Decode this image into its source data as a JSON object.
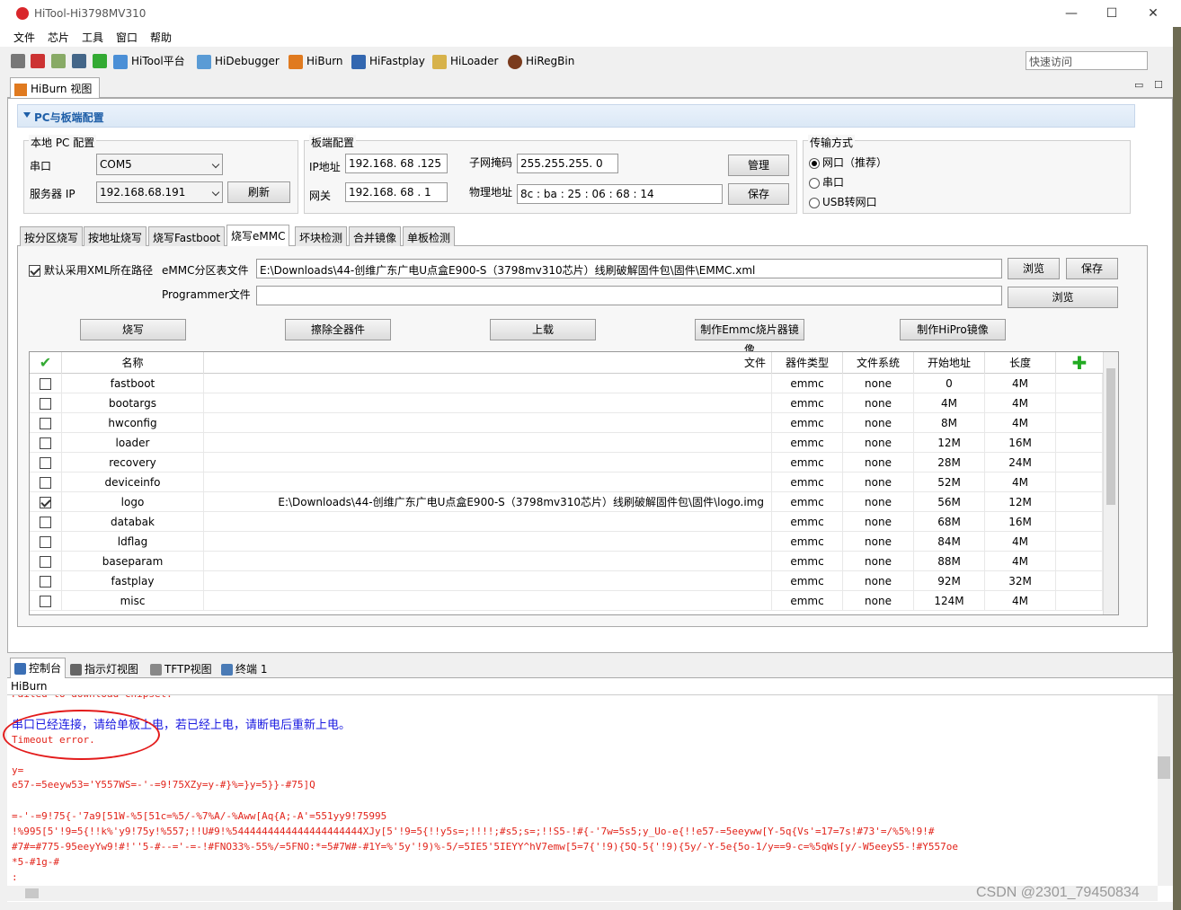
{
  "window": {
    "title": "HiTool-Hi3798MV310",
    "minimize": "—",
    "maximize": "☐",
    "close": "✕"
  },
  "menu": [
    "文件",
    "芯片",
    "工具",
    "窗口",
    "帮助"
  ],
  "toolbar": {
    "buttons": [
      "HiTool平台",
      "HiDebugger",
      "HiBurn",
      "HiFastplay",
      "HiLoader",
      "HiRegBin"
    ],
    "quick_access_placeholder": "快速访问"
  },
  "view_tab": {
    "label": "HiBurn 视图"
  },
  "section": {
    "title": "PC与板端配置"
  },
  "local_pc": {
    "group_label": "本地 PC 配置",
    "serial_label": "串口",
    "serial_value": "COM5",
    "server_ip_label": "服务器 IP",
    "server_ip_value": "192.168.68.191",
    "refresh_label": "刷新"
  },
  "board": {
    "group_label": "板端配置",
    "ip_label": "IP地址",
    "ip_value": "192.168. 68 .125",
    "gateway_label": "网关",
    "gateway_value": "192.168. 68 . 1",
    "mask_label": "子网掩码",
    "mask_value": "255.255.255. 0",
    "mac_label": "物理地址",
    "mac_value": "8c  :  ba  :  25  :  06  :  68  :  14",
    "manage_label": "管理",
    "save_label": "保存"
  },
  "transfer": {
    "group_label": "传输方式",
    "options": [
      "网口（推荐）",
      "串口",
      "USB转网口"
    ],
    "selected": 0
  },
  "tabs": [
    "按分区烧写",
    "按地址烧写",
    "烧写Fastboot",
    "烧写eMMC",
    "坏块检测",
    "合并镜像",
    "单板检测"
  ],
  "active_tab": 3,
  "emmc": {
    "use_xml_path_label": "默认采用XML所在路径",
    "use_xml_path_checked": true,
    "partition_label": "eMMC分区表文件",
    "partition_value": "E:\\Downloads\\44-创维广东广电U点盒E900-S（3798mv310芯片）线刷破解固件包\\固件\\EMMC.xml",
    "browse_label": "浏览",
    "save_label": "保存",
    "programmer_label": "Programmer文件",
    "programmer_value": "",
    "browse2_label": "浏览",
    "actions": [
      "烧写",
      "擦除全器件",
      "上载",
      "制作Emmc烧片器镜像",
      "制作HiPro镜像"
    ]
  },
  "grid": {
    "columns": [
      "名称",
      "文件",
      "器件类型",
      "文件系统",
      "开始地址",
      "长度"
    ],
    "rows": [
      {
        "checked": false,
        "name": "fastboot",
        "file": "",
        "type": "emmc",
        "fs": "none",
        "start": "0",
        "length": "4M"
      },
      {
        "checked": false,
        "name": "bootargs",
        "file": "",
        "type": "emmc",
        "fs": "none",
        "start": "4M",
        "length": "4M"
      },
      {
        "checked": false,
        "name": "hwconfig",
        "file": "",
        "type": "emmc",
        "fs": "none",
        "start": "8M",
        "length": "4M"
      },
      {
        "checked": false,
        "name": "loader",
        "file": "",
        "type": "emmc",
        "fs": "none",
        "start": "12M",
        "length": "16M"
      },
      {
        "checked": false,
        "name": "recovery",
        "file": "",
        "type": "emmc",
        "fs": "none",
        "start": "28M",
        "length": "24M"
      },
      {
        "checked": false,
        "name": "deviceinfo",
        "file": "",
        "type": "emmc",
        "fs": "none",
        "start": "52M",
        "length": "4M"
      },
      {
        "checked": true,
        "name": "logo",
        "file": "E:\\Downloads\\44-创维广东广电U点盒E900-S（3798mv310芯片）线刷破解固件包\\固件\\logo.img",
        "type": "emmc",
        "fs": "none",
        "start": "56M",
        "length": "12M"
      },
      {
        "checked": false,
        "name": "databak",
        "file": "",
        "type": "emmc",
        "fs": "none",
        "start": "68M",
        "length": "16M"
      },
      {
        "checked": false,
        "name": "ldflag",
        "file": "",
        "type": "emmc",
        "fs": "none",
        "start": "84M",
        "length": "4M"
      },
      {
        "checked": false,
        "name": "baseparam",
        "file": "",
        "type": "emmc",
        "fs": "none",
        "start": "88M",
        "length": "4M"
      },
      {
        "checked": false,
        "name": "fastplay",
        "file": "",
        "type": "emmc",
        "fs": "none",
        "start": "92M",
        "length": "32M"
      },
      {
        "checked": false,
        "name": "misc",
        "file": "",
        "type": "emmc",
        "fs": "none",
        "start": "124M",
        "length": "4M"
      }
    ]
  },
  "bottom_tabs": [
    "控制台",
    "指示灯视图",
    "TFTP视图",
    "终端 1"
  ],
  "console": {
    "title": "HiBurn",
    "lines": [
      {
        "cls": "red",
        "text": "Failed to download chipset."
      },
      {
        "cls": "blue",
        "text": "串口已经连接，请给单板上电，若已经上电，请断电后重新上电。"
      },
      {
        "cls": "red",
        "text": "Timeout error."
      },
      {
        "cls": "red",
        "text": ""
      },
      {
        "cls": "red",
        "text": "y="
      },
      {
        "cls": "red",
        "text": "e57-=5eeyw53='Y557WS=-'-=9!75XZy=y-#}%=}y=5}}-#75]Q"
      },
      {
        "cls": "red",
        "text": ""
      },
      {
        "cls": "red",
        "text": "=-'-=9!75{-'7a9[51W-%5[51c=%5/-%7%A/-%Aww[Aq{A;-A'=551yy9!75995"
      },
      {
        "cls": "red",
        "text": "!%995[5'!9=5{!!k%'y9!75y!%557;!!U#9!%5444444444444444444444XJy[5'!9=5{!!y5s=;!!!!;#s5;s=;!!S5-!#{-'7w=5s5;y_Uo-e{!!e57-=5eeyww[Y-5q{Vs'=17=7s!#73'=/%5%!9!#"
      },
      {
        "cls": "red",
        "text": "#7#=#775-95eeyYw9!#!''5-#--='-=-!#FNO33%-55%/=5FNO:*=5#7W#-#1Y=%'5y'!9)%-5/=5IE5'5IEYY^hV7emw[5=7{'!9){5Q-5{'!9){5y/-Y-5e{5o-1/y==9-c=%5qWs[y/-W5eeyS5-!#Y557oe"
      },
      {
        "cls": "red",
        "text": "*5-#1g-#"
      },
      {
        "cls": "red",
        "text": ":"
      }
    ]
  },
  "watermark": "CSDN @2301_79450834",
  "colors": {
    "accent": "#1f5fa8",
    "error": "#e2231a",
    "info": "#1a1ae0",
    "annotation": "#e31b1b"
  }
}
